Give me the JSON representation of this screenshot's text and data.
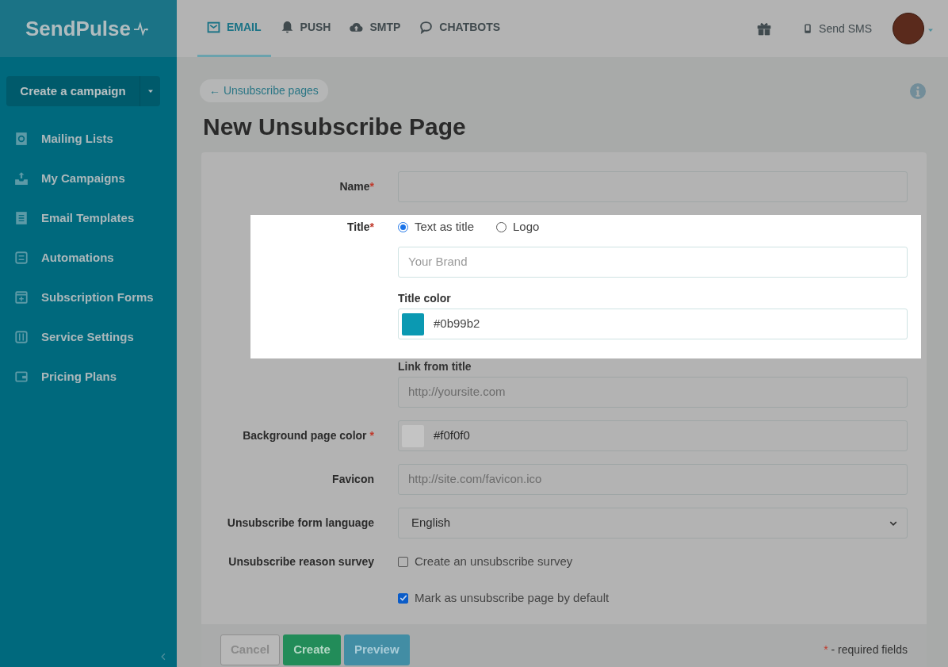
{
  "sidebar": {
    "logo": "SendPulse",
    "create_button": "Create a campaign",
    "items": [
      {
        "label": "Mailing Lists"
      },
      {
        "label": "My Campaigns"
      },
      {
        "label": "Email Templates"
      },
      {
        "label": "Automations"
      },
      {
        "label": "Subscription Forms"
      },
      {
        "label": "Service Settings"
      },
      {
        "label": "Pricing Plans"
      }
    ]
  },
  "top_nav": {
    "tabs": [
      {
        "label": "EMAIL",
        "selected": true
      },
      {
        "label": "PUSH",
        "selected": false
      },
      {
        "label": "SMTP",
        "selected": false
      },
      {
        "label": "CHATBOTS",
        "selected": false
      }
    ],
    "send_sms": "Send SMS"
  },
  "breadcrumb": "← Unsubscribe pages",
  "page_title": "New Unsubscribe Page",
  "form": {
    "rows": [
      {
        "kind": "input",
        "label": "Name",
        "required_mark": "*",
        "highlighted": false
      },
      {
        "kind": "radio",
        "label": "Title",
        "required_mark": "*",
        "highlighted": true,
        "options": [
          {
            "label": "Text as title",
            "selected": true
          },
          {
            "label": "Logo",
            "selected": false
          }
        ]
      },
      {
        "kind": "input",
        "placeholder": "Your Brand",
        "highlighted": true
      },
      {
        "kind": "sublabel",
        "label": "Title color",
        "highlighted": true
      },
      {
        "kind": "color",
        "value": "#0b99b2",
        "color": "#0b99b2",
        "highlighted": true
      },
      {
        "kind": "sublabel",
        "label": "Link from title",
        "highlighted": false
      },
      {
        "kind": "input",
        "placeholder": "http://yoursite.com",
        "highlighted": false
      },
      {
        "kind": "color",
        "label": "Background page color",
        "required_mark": "*",
        "value": "#f0f0f0",
        "color": "#c4c4c4",
        "highlighted": false
      },
      {
        "kind": "input",
        "label": "Favicon",
        "placeholder": "http://site.com/favicon.ico",
        "highlighted": false
      },
      {
        "kind": "select",
        "label": "Unsubscribe form language",
        "value": "English",
        "highlighted": false
      },
      {
        "kind": "checkbox",
        "label": "Unsubscribe reason survey",
        "text": "Create an unsubscribe survey",
        "checked": false,
        "highlighted": false
      },
      {
        "kind": "checkbox",
        "text": "Mark as unsubscribe page by default",
        "checked": true,
        "highlighted": false
      }
    ]
  },
  "footer": {
    "buttons": [
      {
        "label": "Cancel",
        "kind": "cancel"
      },
      {
        "label": "Create",
        "kind": "create"
      },
      {
        "label": "Preview",
        "kind": "preview"
      }
    ],
    "required_note_mark": "*",
    "required_note": "- required fields"
  }
}
